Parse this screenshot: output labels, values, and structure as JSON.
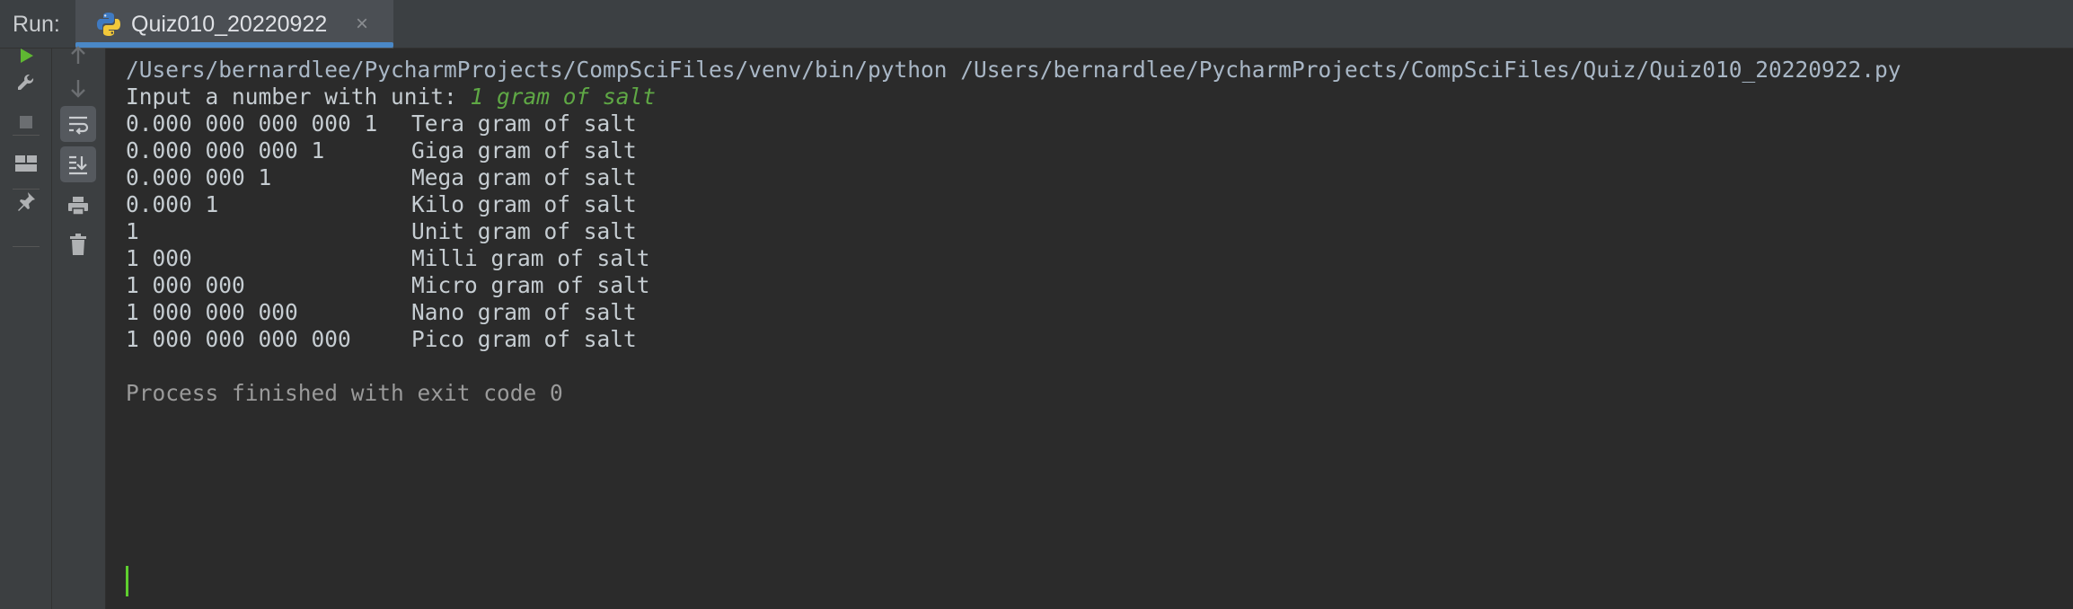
{
  "run_panel": {
    "label": "Run:",
    "tab": {
      "title": "Quiz010_20220922",
      "icon": "python-icon",
      "close_glyph": "×"
    }
  },
  "toolbar_left": {
    "buttons": [
      {
        "name": "rerun-icon",
        "interactable": true
      },
      {
        "name": "wrench-icon",
        "interactable": true
      },
      {
        "name": "stop-icon",
        "interactable": true
      },
      {
        "name": "layout-icon",
        "interactable": true
      },
      {
        "name": "pin-icon",
        "interactable": true
      }
    ]
  },
  "toolbar_second": {
    "buttons": [
      {
        "name": "up-arrow-icon",
        "interactable": true
      },
      {
        "name": "down-arrow-icon",
        "interactable": true
      },
      {
        "name": "soft-wrap-icon",
        "interactable": true
      },
      {
        "name": "scroll-to-end-icon",
        "interactable": true
      },
      {
        "name": "print-icon",
        "interactable": true
      },
      {
        "name": "trash-icon",
        "interactable": true
      }
    ]
  },
  "console": {
    "command": "/Users/bernardlee/PycharmProjects/CompSciFiles/venv/bin/python /Users/bernardlee/PycharmProjects/CompSciFiles/Quiz/Quiz010_20220922.py",
    "prompt": "Input a number with unit: ",
    "user_input": "1 gram of salt",
    "rows": [
      {
        "value": "0.000 000 000 000 1",
        "unit": "Tera gram of salt"
      },
      {
        "value": "0.000 000 000 1",
        "unit": "Giga gram of salt"
      },
      {
        "value": "0.000 000 1",
        "unit": "Mega gram of salt"
      },
      {
        "value": "0.000 1",
        "unit": "Kilo gram of salt"
      },
      {
        "value": "1",
        "unit": "Unit gram of salt"
      },
      {
        "value": "1 000",
        "unit": "Milli gram of salt"
      },
      {
        "value": "1 000 000",
        "unit": "Micro gram of salt"
      },
      {
        "value": "1 000 000 000",
        "unit": "Nano gram of salt"
      },
      {
        "value": "1 000 000 000 000",
        "unit": "Pico gram of salt"
      }
    ],
    "exit_message": "Process finished with exit code 0"
  },
  "colors": {
    "background": "#2b2b2b",
    "toolbar": "#3c3f41",
    "tab_accent": "#4a88c7",
    "run_green": "#5fb832",
    "user_input": "#5fa845",
    "text": "#c6cdd2"
  }
}
